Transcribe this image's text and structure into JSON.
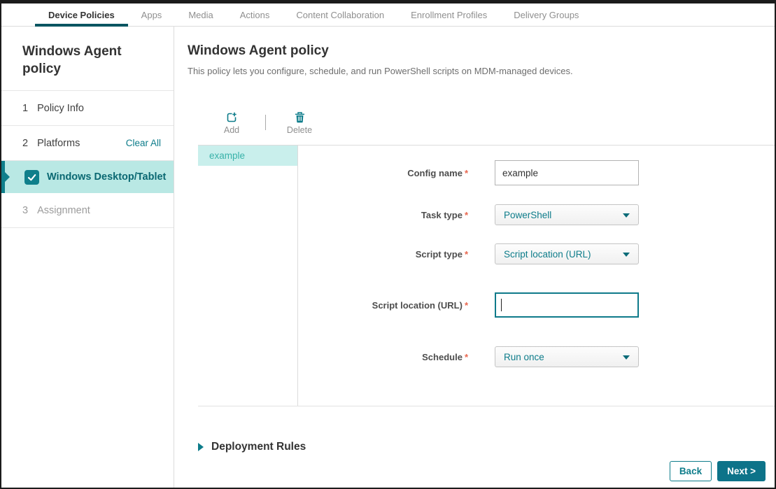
{
  "nav": {
    "tabs": [
      {
        "label": "Device Policies",
        "active": true
      },
      {
        "label": "Apps",
        "active": false
      },
      {
        "label": "Media",
        "active": false
      },
      {
        "label": "Actions",
        "active": false
      },
      {
        "label": "Content Collaboration",
        "active": false
      },
      {
        "label": "Enrollment Profiles",
        "active": false
      },
      {
        "label": "Delivery Groups",
        "active": false
      }
    ]
  },
  "sidebar": {
    "title": "Windows Agent policy",
    "steps": [
      {
        "number": "1",
        "label": "Policy Info"
      },
      {
        "number": "2",
        "label": "Platforms",
        "action": "Clear All"
      },
      {
        "number": "3",
        "label": "Assignment"
      }
    ],
    "platform": {
      "label": "Windows Desktop/Tablet",
      "checked": true
    }
  },
  "main": {
    "title": "Windows Agent policy",
    "description": "This policy lets you configure, schedule, and run PowerShell scripts on MDM-managed devices.",
    "toolbar": {
      "add_label": "Add",
      "delete_label": "Delete"
    },
    "config_list": [
      {
        "name": "example",
        "selected": true
      }
    ],
    "form": {
      "required_marker": "*",
      "fields": [
        {
          "label": "Config name",
          "type": "text",
          "value": "example",
          "required": true
        },
        {
          "label": "Task type",
          "type": "select",
          "value": "PowerShell",
          "required": true
        },
        {
          "label": "Script type",
          "type": "select",
          "value": "Script location (URL)",
          "required": true
        },
        {
          "label": "Script location (URL)",
          "type": "text",
          "value": "",
          "required": true,
          "focused": true
        },
        {
          "label": "Schedule",
          "type": "select",
          "value": "Run once",
          "required": true
        }
      ]
    },
    "deployment_rules": {
      "label": "Deployment Rules",
      "expanded": false
    },
    "footer": {
      "back_label": "Back",
      "next_label": "Next >"
    }
  },
  "colors": {
    "accent": "#0d7c8a",
    "active_tab_underline": "#0a5561",
    "platform_selected_bg": "#b9e8e4",
    "checkbox_fill": "#0f7f8b",
    "list_selected_bg": "#c9efec",
    "list_selected_text": "#38b2a9",
    "next_button_bg": "#0d7389",
    "required_marker": "#e8674f"
  }
}
